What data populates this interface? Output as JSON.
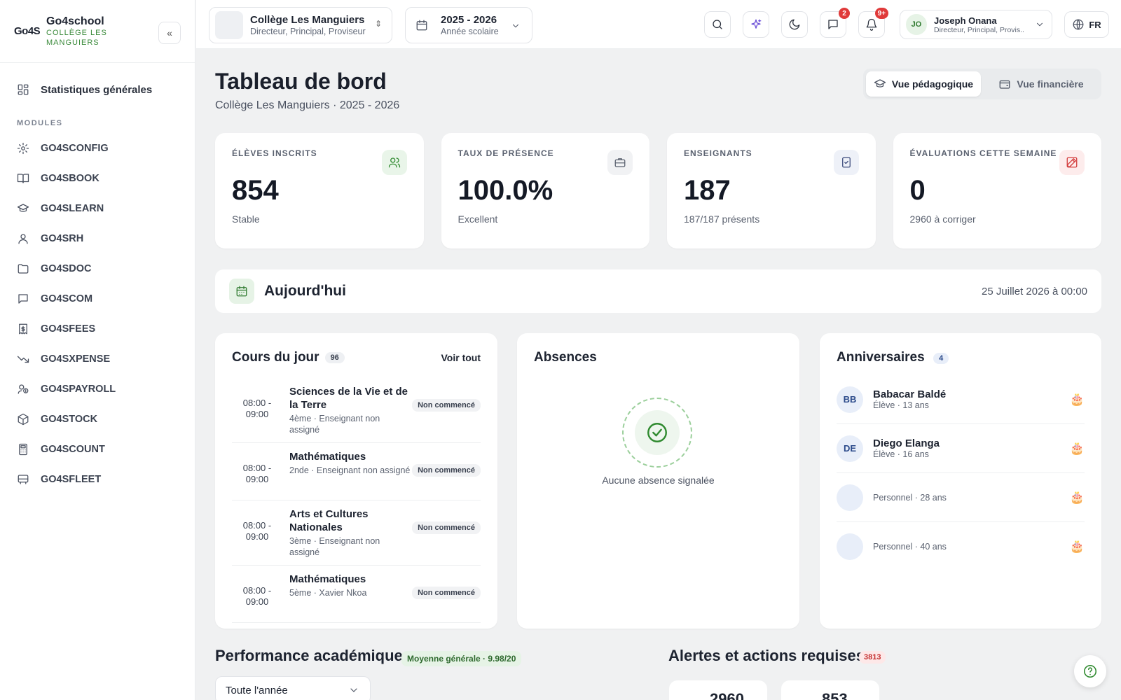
{
  "brand": {
    "logo": "Go4S",
    "name": "Go4school",
    "school": "COLLÈGE LES MANGUIERS"
  },
  "sidebar": {
    "main_item": {
      "label": "Statistiques générales",
      "icon": "dashboard-icon"
    },
    "modules_label": "MODULES",
    "items": [
      {
        "label": "GO4SCONFIG",
        "icon": "gear-icon"
      },
      {
        "label": "GO4SBOOK",
        "icon": "book-icon"
      },
      {
        "label": "GO4SLEARN",
        "icon": "graduation-cap-icon"
      },
      {
        "label": "GO4SRH",
        "icon": "user-icon"
      },
      {
        "label": "GO4SDOC",
        "icon": "folder-icon"
      },
      {
        "label": "GO4SCOM",
        "icon": "message-icon"
      },
      {
        "label": "GO4SFEES",
        "icon": "receipt-icon"
      },
      {
        "label": "GO4SXPENSE",
        "icon": "trending-down-icon"
      },
      {
        "label": "GO4SPAYROLL",
        "icon": "payroll-icon"
      },
      {
        "label": "GO4STOCK",
        "icon": "box-icon"
      },
      {
        "label": "GO4SCOUNT",
        "icon": "calculator-icon"
      },
      {
        "label": "GO4SFLEET",
        "icon": "bus-icon"
      }
    ]
  },
  "topbar": {
    "school": {
      "name": "Collège Les Manguiers",
      "role": "Directeur, Principal, Proviseur"
    },
    "year": {
      "value": "2025 - 2026",
      "label": "Année scolaire"
    },
    "messages_badge": "2",
    "notifications_badge": "9+",
    "user": {
      "initials": "JO",
      "name": "Joseph Onana",
      "role": "Directeur, Principal, Provis..."
    },
    "language": "FR"
  },
  "page": {
    "title": "Tableau de bord",
    "subtitle": "Collège Les Manguiers · 2025 - 2026",
    "view_tabs": [
      {
        "label": "Vue pédagogique",
        "active": true
      },
      {
        "label": "Vue financière",
        "active": false
      }
    ]
  },
  "stats": [
    {
      "label": "Élèves inscrits",
      "value": "854",
      "note": "Stable",
      "icon": "users-icon",
      "color": "#2f8a2f",
      "bg": "#e9f5e9"
    },
    {
      "label": "Taux de présence",
      "value": "100.0%",
      "note": "Excellent",
      "icon": "briefcase-icon",
      "color": "#5b6270",
      "bg": "#f1f2f4"
    },
    {
      "label": "Enseignants",
      "value": "187",
      "note": "187/187 présents",
      "icon": "clipboard-check-icon",
      "color": "#3b4a7a",
      "bg": "#eef1f8"
    },
    {
      "label": "Évaluations cette semaine",
      "value": "0",
      "note": "2960 à corriger",
      "icon": "edit-icon",
      "color": "#d23a3a",
      "bg": "#fdecec"
    }
  ],
  "today": {
    "title": "Aujourd'hui",
    "date": "25 Juillet 2026 à 00:00"
  },
  "courses": {
    "title": "Cours du jour",
    "count": "96",
    "see_all": "Voir tout",
    "items": [
      {
        "time_start": "08:00 -",
        "time_end": "09:00",
        "name": "Sciences de la Vie et de la Terre",
        "meta": "4ème · Enseignant non assigné",
        "status": "Non commencé"
      },
      {
        "time_start": "08:00 -",
        "time_end": "09:00",
        "name": "Mathématiques",
        "meta": "2nde · Enseignant non assigné",
        "status": "Non commencé"
      },
      {
        "time_start": "08:00 -",
        "time_end": "09:00",
        "name": "Arts et Cultures Nationales",
        "meta": "3ème · Enseignant non assigné",
        "status": "Non commencé"
      },
      {
        "time_start": "08:00 -",
        "time_end": "09:00",
        "name": "Mathématiques",
        "meta": "5ème · Xavier Nkoa",
        "status": "Non commencé"
      }
    ]
  },
  "absences": {
    "title": "Absences",
    "empty": "Aucune absence signalée"
  },
  "birthdays": {
    "title": "Anniversaires",
    "count": "4",
    "items": [
      {
        "initials": "BB",
        "name": "Babacar Baldé",
        "meta": "Élève · 13 ans"
      },
      {
        "initials": "DE",
        "name": "Diego Elanga",
        "meta": "Élève · 16 ans"
      },
      {
        "initials": "",
        "name": "",
        "meta": "Personnel · 28 ans"
      },
      {
        "initials": "",
        "name": "",
        "meta": "Personnel · 40 ans"
      }
    ]
  },
  "performance": {
    "title": "Performance académique",
    "badge": "Moyenne générale · 9.98/20",
    "filter": "Toute l'année"
  },
  "alerts": {
    "title": "Alertes et actions requises",
    "count": "3813",
    "cards": [
      {
        "value": "2960"
      },
      {
        "value": "853"
      }
    ]
  }
}
